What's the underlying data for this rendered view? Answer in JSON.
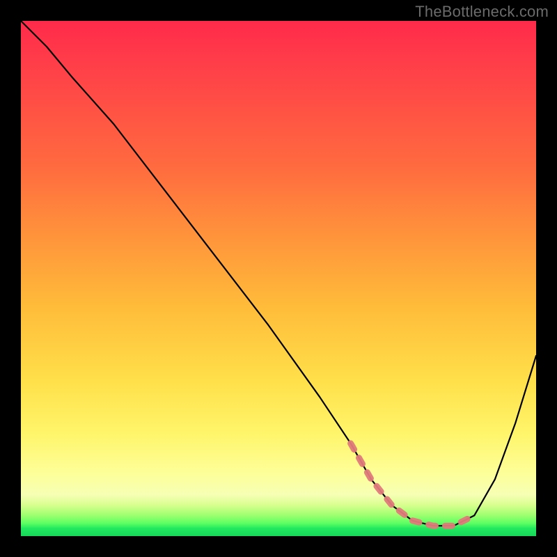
{
  "watermark": "TheBottleneck.com",
  "chart_data": {
    "type": "line",
    "title": "",
    "xlabel": "",
    "ylabel": "",
    "xlim": [
      0,
      100
    ],
    "ylim": [
      0,
      100
    ],
    "grid": false,
    "series": [
      {
        "name": "bottleneck-curve",
        "x": [
          0,
          5,
          10,
          18,
          28,
          38,
          48,
          58,
          64,
          68,
          72,
          76,
          80,
          84,
          88,
          92,
          96,
          100
        ],
        "y": [
          100,
          95,
          89,
          80,
          67,
          54,
          41,
          27,
          18,
          11,
          6,
          3,
          2,
          2,
          4,
          11,
          22,
          35
        ]
      }
    ],
    "annotations": [
      {
        "name": "optimal-range",
        "style": "dashed-pink",
        "x": [
          64,
          68,
          72,
          76,
          80,
          84,
          88
        ],
        "y": [
          18,
          11,
          6,
          3,
          2,
          2,
          4
        ]
      }
    ],
    "background": {
      "type": "vertical-gradient",
      "stops": [
        {
          "pos": 0.0,
          "color": "#ff2a4a"
        },
        {
          "pos": 0.5,
          "color": "#ffb93a"
        },
        {
          "pos": 0.85,
          "color": "#fdff9a"
        },
        {
          "pos": 0.97,
          "color": "#5dff63"
        },
        {
          "pos": 1.0,
          "color": "#16d85a"
        }
      ]
    }
  }
}
